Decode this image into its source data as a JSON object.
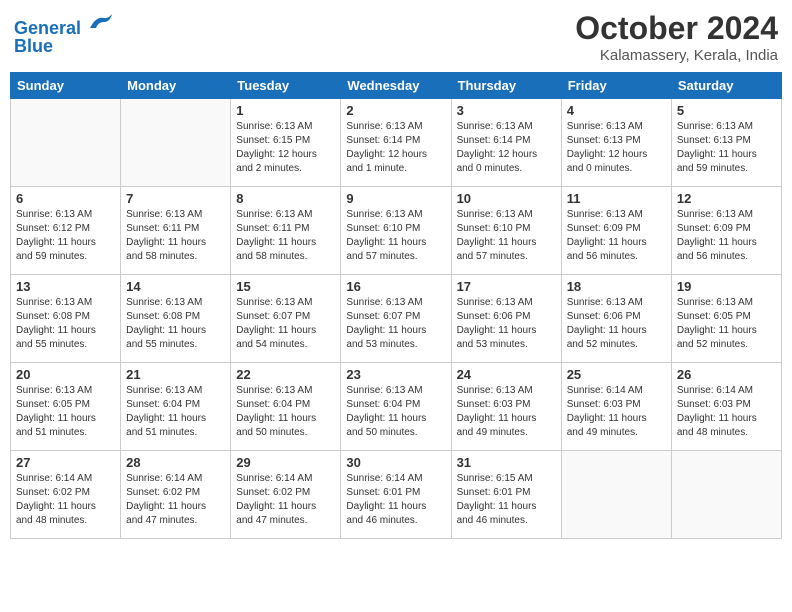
{
  "header": {
    "logo_line1": "General",
    "logo_line2": "Blue",
    "month": "October 2024",
    "location": "Kalamassery, Kerala, India"
  },
  "weekdays": [
    "Sunday",
    "Monday",
    "Tuesday",
    "Wednesday",
    "Thursday",
    "Friday",
    "Saturday"
  ],
  "weeks": [
    [
      {
        "day": "",
        "empty": true
      },
      {
        "day": "",
        "empty": true
      },
      {
        "day": "1",
        "sunrise": "Sunrise: 6:13 AM",
        "sunset": "Sunset: 6:15 PM",
        "daylight": "Daylight: 12 hours and 2 minutes."
      },
      {
        "day": "2",
        "sunrise": "Sunrise: 6:13 AM",
        "sunset": "Sunset: 6:14 PM",
        "daylight": "Daylight: 12 hours and 1 minute."
      },
      {
        "day": "3",
        "sunrise": "Sunrise: 6:13 AM",
        "sunset": "Sunset: 6:14 PM",
        "daylight": "Daylight: 12 hours and 0 minutes."
      },
      {
        "day": "4",
        "sunrise": "Sunrise: 6:13 AM",
        "sunset": "Sunset: 6:13 PM",
        "daylight": "Daylight: 12 hours and 0 minutes."
      },
      {
        "day": "5",
        "sunrise": "Sunrise: 6:13 AM",
        "sunset": "Sunset: 6:13 PM",
        "daylight": "Daylight: 11 hours and 59 minutes."
      }
    ],
    [
      {
        "day": "6",
        "sunrise": "Sunrise: 6:13 AM",
        "sunset": "Sunset: 6:12 PM",
        "daylight": "Daylight: 11 hours and 59 minutes."
      },
      {
        "day": "7",
        "sunrise": "Sunrise: 6:13 AM",
        "sunset": "Sunset: 6:11 PM",
        "daylight": "Daylight: 11 hours and 58 minutes."
      },
      {
        "day": "8",
        "sunrise": "Sunrise: 6:13 AM",
        "sunset": "Sunset: 6:11 PM",
        "daylight": "Daylight: 11 hours and 58 minutes."
      },
      {
        "day": "9",
        "sunrise": "Sunrise: 6:13 AM",
        "sunset": "Sunset: 6:10 PM",
        "daylight": "Daylight: 11 hours and 57 minutes."
      },
      {
        "day": "10",
        "sunrise": "Sunrise: 6:13 AM",
        "sunset": "Sunset: 6:10 PM",
        "daylight": "Daylight: 11 hours and 57 minutes."
      },
      {
        "day": "11",
        "sunrise": "Sunrise: 6:13 AM",
        "sunset": "Sunset: 6:09 PM",
        "daylight": "Daylight: 11 hours and 56 minutes."
      },
      {
        "day": "12",
        "sunrise": "Sunrise: 6:13 AM",
        "sunset": "Sunset: 6:09 PM",
        "daylight": "Daylight: 11 hours and 56 minutes."
      }
    ],
    [
      {
        "day": "13",
        "sunrise": "Sunrise: 6:13 AM",
        "sunset": "Sunset: 6:08 PM",
        "daylight": "Daylight: 11 hours and 55 minutes."
      },
      {
        "day": "14",
        "sunrise": "Sunrise: 6:13 AM",
        "sunset": "Sunset: 6:08 PM",
        "daylight": "Daylight: 11 hours and 55 minutes."
      },
      {
        "day": "15",
        "sunrise": "Sunrise: 6:13 AM",
        "sunset": "Sunset: 6:07 PM",
        "daylight": "Daylight: 11 hours and 54 minutes."
      },
      {
        "day": "16",
        "sunrise": "Sunrise: 6:13 AM",
        "sunset": "Sunset: 6:07 PM",
        "daylight": "Daylight: 11 hours and 53 minutes."
      },
      {
        "day": "17",
        "sunrise": "Sunrise: 6:13 AM",
        "sunset": "Sunset: 6:06 PM",
        "daylight": "Daylight: 11 hours and 53 minutes."
      },
      {
        "day": "18",
        "sunrise": "Sunrise: 6:13 AM",
        "sunset": "Sunset: 6:06 PM",
        "daylight": "Daylight: 11 hours and 52 minutes."
      },
      {
        "day": "19",
        "sunrise": "Sunrise: 6:13 AM",
        "sunset": "Sunset: 6:05 PM",
        "daylight": "Daylight: 11 hours and 52 minutes."
      }
    ],
    [
      {
        "day": "20",
        "sunrise": "Sunrise: 6:13 AM",
        "sunset": "Sunset: 6:05 PM",
        "daylight": "Daylight: 11 hours and 51 minutes."
      },
      {
        "day": "21",
        "sunrise": "Sunrise: 6:13 AM",
        "sunset": "Sunset: 6:04 PM",
        "daylight": "Daylight: 11 hours and 51 minutes."
      },
      {
        "day": "22",
        "sunrise": "Sunrise: 6:13 AM",
        "sunset": "Sunset: 6:04 PM",
        "daylight": "Daylight: 11 hours and 50 minutes."
      },
      {
        "day": "23",
        "sunrise": "Sunrise: 6:13 AM",
        "sunset": "Sunset: 6:04 PM",
        "daylight": "Daylight: 11 hours and 50 minutes."
      },
      {
        "day": "24",
        "sunrise": "Sunrise: 6:13 AM",
        "sunset": "Sunset: 6:03 PM",
        "daylight": "Daylight: 11 hours and 49 minutes."
      },
      {
        "day": "25",
        "sunrise": "Sunrise: 6:14 AM",
        "sunset": "Sunset: 6:03 PM",
        "daylight": "Daylight: 11 hours and 49 minutes."
      },
      {
        "day": "26",
        "sunrise": "Sunrise: 6:14 AM",
        "sunset": "Sunset: 6:03 PM",
        "daylight": "Daylight: 11 hours and 48 minutes."
      }
    ],
    [
      {
        "day": "27",
        "sunrise": "Sunrise: 6:14 AM",
        "sunset": "Sunset: 6:02 PM",
        "daylight": "Daylight: 11 hours and 48 minutes."
      },
      {
        "day": "28",
        "sunrise": "Sunrise: 6:14 AM",
        "sunset": "Sunset: 6:02 PM",
        "daylight": "Daylight: 11 hours and 47 minutes."
      },
      {
        "day": "29",
        "sunrise": "Sunrise: 6:14 AM",
        "sunset": "Sunset: 6:02 PM",
        "daylight": "Daylight: 11 hours and 47 minutes."
      },
      {
        "day": "30",
        "sunrise": "Sunrise: 6:14 AM",
        "sunset": "Sunset: 6:01 PM",
        "daylight": "Daylight: 11 hours and 46 minutes."
      },
      {
        "day": "31",
        "sunrise": "Sunrise: 6:15 AM",
        "sunset": "Sunset: 6:01 PM",
        "daylight": "Daylight: 11 hours and 46 minutes."
      },
      {
        "day": "",
        "empty": true
      },
      {
        "day": "",
        "empty": true
      }
    ]
  ]
}
